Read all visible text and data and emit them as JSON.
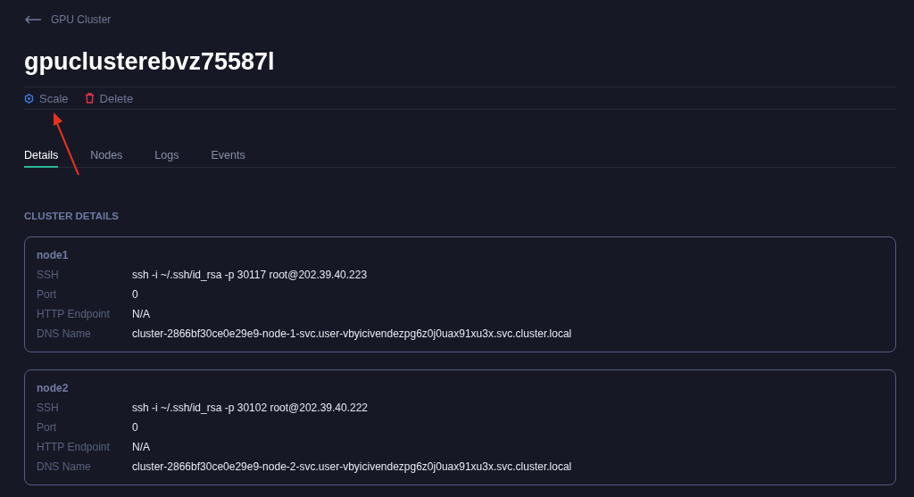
{
  "breadcrumb": {
    "label": "GPU Cluster"
  },
  "title": "gpuclusterebvz75587l",
  "actions": [
    {
      "label": "Scale",
      "kind": "scale"
    },
    {
      "label": "Delete",
      "kind": "delete"
    }
  ],
  "tabs": [
    {
      "label": "Details",
      "selected": true
    },
    {
      "label": "Nodes",
      "selected": false
    },
    {
      "label": "Logs",
      "selected": false
    },
    {
      "label": "Events",
      "selected": false
    }
  ],
  "section_title": "CLUSTER DETAILS",
  "nodes": [
    {
      "name": "node1",
      "fields": [
        {
          "label": "SSH",
          "value": "ssh -i ~/.ssh/id_rsa -p 30117 root@202.39.40.223"
        },
        {
          "label": "Port",
          "value": "0"
        },
        {
          "label": "HTTP Endpoint",
          "value": "N/A"
        },
        {
          "label": "DNS Name",
          "value": "cluster-2866bf30ce0e29e9-node-1-svc.user-vbyicivendezpg6z0j0uax91xu3x.svc.cluster.local"
        }
      ]
    },
    {
      "name": "node2",
      "fields": [
        {
          "label": "SSH",
          "value": "ssh -i ~/.ssh/id_rsa -p 30102 root@202.39.40.222"
        },
        {
          "label": "Port",
          "value": "0"
        },
        {
          "label": "HTTP Endpoint",
          "value": "N/A"
        },
        {
          "label": "DNS Name",
          "value": "cluster-2866bf30ce0e29e9-node-2-svc.user-vbyicivendezpg6z0j0uax91xu3x.svc.cluster.local"
        }
      ]
    }
  ]
}
